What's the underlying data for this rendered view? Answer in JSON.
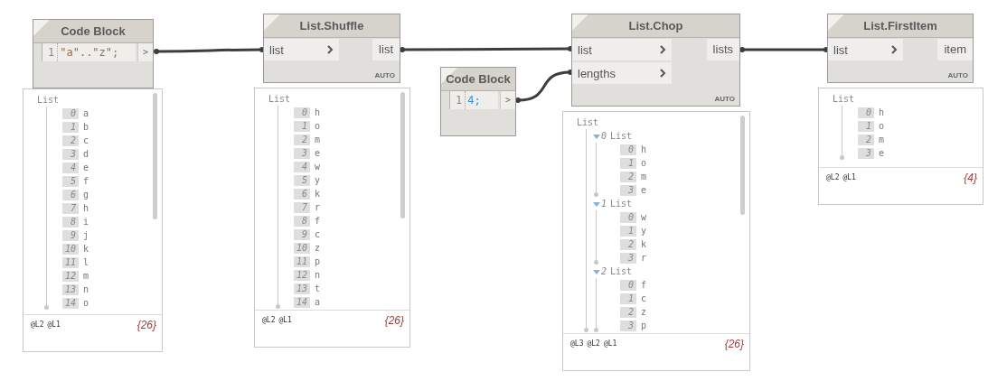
{
  "nodes": [
    {
      "kind": "code",
      "title": "Code Block",
      "lines": [
        {
          "number": "1",
          "code": "\"a\"..\"z\";",
          "kind": "string"
        }
      ],
      "output": ">",
      "preview": {
        "label": "List",
        "items": [
          {
            "index": "0",
            "value": "a"
          },
          {
            "index": "1",
            "value": "b"
          },
          {
            "index": "2",
            "value": "c"
          },
          {
            "index": "3",
            "value": "d"
          },
          {
            "index": "4",
            "value": "e"
          },
          {
            "index": "5",
            "value": "f"
          },
          {
            "index": "6",
            "value": "g"
          },
          {
            "index": "7",
            "value": "h"
          },
          {
            "index": "8",
            "value": "i"
          },
          {
            "index": "9",
            "value": "j"
          },
          {
            "index": "10",
            "value": "k"
          },
          {
            "index": "11",
            "value": "l"
          },
          {
            "index": "12",
            "value": "m"
          },
          {
            "index": "13",
            "value": "n"
          },
          {
            "index": "14",
            "value": "o"
          }
        ],
        "levels": [
          "@L2",
          "@L1"
        ],
        "count": "{26}"
      }
    },
    {
      "kind": "function",
      "title": "List.Shuffle",
      "inputs": [
        {
          "name": "list"
        }
      ],
      "outputs": [
        {
          "name": "list"
        }
      ],
      "lacing": "AUTO",
      "preview": {
        "label": "List",
        "items": [
          {
            "index": "0",
            "value": "h"
          },
          {
            "index": "1",
            "value": "o"
          },
          {
            "index": "2",
            "value": "m"
          },
          {
            "index": "3",
            "value": "e"
          },
          {
            "index": "4",
            "value": "w"
          },
          {
            "index": "5",
            "value": "y"
          },
          {
            "index": "6",
            "value": "k"
          },
          {
            "index": "7",
            "value": "r"
          },
          {
            "index": "8",
            "value": "f"
          },
          {
            "index": "9",
            "value": "c"
          },
          {
            "index": "10",
            "value": "z"
          },
          {
            "index": "11",
            "value": "p"
          },
          {
            "index": "12",
            "value": "n"
          },
          {
            "index": "13",
            "value": "t"
          },
          {
            "index": "14",
            "value": "a"
          }
        ],
        "levels": [
          "@L2",
          "@L1"
        ],
        "count": "{26}"
      }
    },
    {
      "kind": "code",
      "title": "Code Block",
      "lines": [
        {
          "number": "1",
          "code": "4;",
          "kind": "number"
        }
      ],
      "output": ">"
    },
    {
      "kind": "function",
      "title": "List.Chop",
      "inputs": [
        {
          "name": "list"
        },
        {
          "name": "lengths"
        }
      ],
      "outputs": [
        {
          "name": "lists"
        }
      ],
      "lacing": "AUTO",
      "preview": {
        "label": "List",
        "items": [
          {
            "index": "0",
            "label": "List",
            "expanded": true,
            "children": [
              {
                "index": "0",
                "value": "h"
              },
              {
                "index": "1",
                "value": "o"
              },
              {
                "index": "2",
                "value": "m"
              },
              {
                "index": "3",
                "value": "e"
              }
            ]
          },
          {
            "index": "1",
            "label": "List",
            "expanded": true,
            "children": [
              {
                "index": "0",
                "value": "w"
              },
              {
                "index": "1",
                "value": "y"
              },
              {
                "index": "2",
                "value": "k"
              },
              {
                "index": "3",
                "value": "r"
              }
            ]
          },
          {
            "index": "2",
            "label": "List",
            "expanded": true,
            "children": [
              {
                "index": "0",
                "value": "f"
              },
              {
                "index": "1",
                "value": "c"
              },
              {
                "index": "2",
                "value": "z"
              },
              {
                "index": "3",
                "value": "p"
              }
            ]
          }
        ],
        "levels": [
          "@L3",
          "@L2",
          "@L1"
        ],
        "count": "{26}"
      }
    },
    {
      "kind": "function",
      "title": "List.FirstItem",
      "inputs": [
        {
          "name": "list"
        }
      ],
      "outputs": [
        {
          "name": "item"
        }
      ],
      "lacing": "AUTO",
      "preview": {
        "label": "List",
        "items": [
          {
            "index": "0",
            "value": "h"
          },
          {
            "index": "1",
            "value": "o"
          },
          {
            "index": "2",
            "value": "m"
          },
          {
            "index": "3",
            "value": "e"
          }
        ],
        "levels": [
          "@L2",
          "@L1"
        ],
        "count": "{4}"
      }
    }
  ]
}
